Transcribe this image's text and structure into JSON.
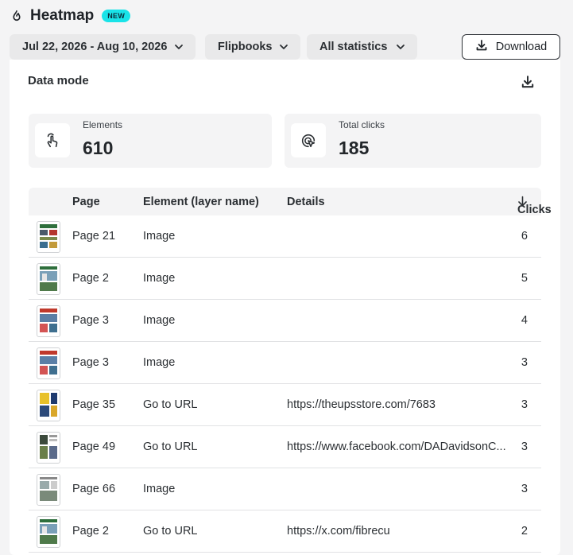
{
  "header": {
    "title": "Heatmap",
    "badge": "NEW"
  },
  "toolbar": {
    "date_range": "Jul 22, 2026 - Aug 10, 2026",
    "type_filter": "Flipbooks",
    "stats_filter": "All statistics",
    "download_label": "Download"
  },
  "panel": {
    "title": "Data mode"
  },
  "stats": {
    "elements": {
      "label": "Elements",
      "value": "610"
    },
    "clicks": {
      "label": "Total clicks",
      "value": "185"
    }
  },
  "table": {
    "columns": {
      "page": "Page",
      "element": "Element (layer name)",
      "details": "Details",
      "clicks": "Clicks"
    },
    "rows": [
      {
        "page": "Page 21",
        "element": "Image",
        "details": "",
        "clicks": "6"
      },
      {
        "page": "Page 2",
        "element": "Image",
        "details": "",
        "clicks": "5"
      },
      {
        "page": "Page 3",
        "element": "Image",
        "details": "",
        "clicks": "4"
      },
      {
        "page": "Page 3",
        "element": "Image",
        "details": "",
        "clicks": "3"
      },
      {
        "page": "Page 35",
        "element": "Go to URL",
        "details": "https://theupsstore.com/7683",
        "clicks": "3"
      },
      {
        "page": "Page 49",
        "element": "Go to URL",
        "details": "https://www.facebook.com/DADavidsonC...",
        "clicks": "3"
      },
      {
        "page": "Page 66",
        "element": "Image",
        "details": "",
        "clicks": "3"
      },
      {
        "page": "Page 2",
        "element": "Go to URL",
        "details": "https://x.com/fibrecu",
        "clicks": "2"
      }
    ]
  },
  "colors": {
    "badge": "#19e3e8",
    "page_bg": "#f4f4f5",
    "panel_bg": "#ffffff"
  }
}
